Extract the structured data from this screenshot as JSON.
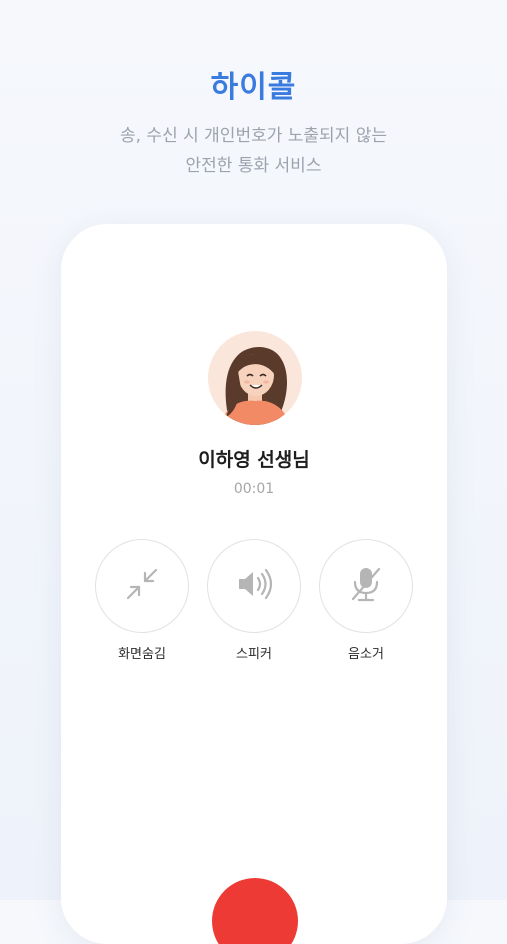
{
  "promo": {
    "title": "하이콜",
    "subtitle_line1": "송, 수신 시 개인번호가 노출되지 않는",
    "subtitle_line2": "안전한 통화 서비스"
  },
  "call": {
    "caller_name": "이하영 선생님",
    "timer": "00:01",
    "controls": [
      {
        "label": "화면숨김",
        "icon": "minimize-icon"
      },
      {
        "label": "스피커",
        "icon": "speaker-icon"
      },
      {
        "label": "음소거",
        "icon": "mute-mic-icon"
      }
    ],
    "end_call_color": "#ee3a34"
  },
  "colors": {
    "accent": "#3a7be0",
    "end_call": "#ee3a34"
  }
}
